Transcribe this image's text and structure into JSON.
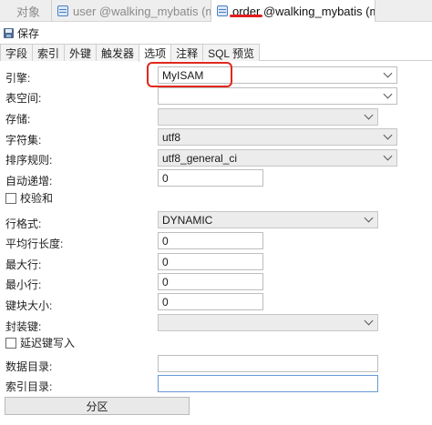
{
  "tabs": [
    {
      "label": "对象"
    },
    {
      "label": "user @walking_mybatis (my..."
    },
    {
      "label": "order @walking_mybatis (m..."
    }
  ],
  "toolbar": {
    "save_label": "保存"
  },
  "subtabs": [
    "字段",
    "索引",
    "外键",
    "触发器",
    "选项",
    "注释",
    "SQL 预览"
  ],
  "form": {
    "engine": {
      "label": "引擎:",
      "value": "MyISAM"
    },
    "tablespace": {
      "label": "表空间:",
      "value": ""
    },
    "storage": {
      "label": "存储:",
      "value": ""
    },
    "charset": {
      "label": "字符集:",
      "value": "utf8"
    },
    "collation": {
      "label": "排序规则:",
      "value": "utf8_general_ci"
    },
    "auto_increment": {
      "label": "自动递增:",
      "value": "0"
    },
    "checksum": {
      "label": "校验和",
      "checked": false
    },
    "row_format": {
      "label": "行格式:",
      "value": "DYNAMIC"
    },
    "avg_row_length": {
      "label": "平均行长度:",
      "value": "0"
    },
    "max_rows": {
      "label": "最大行:",
      "value": "0"
    },
    "min_rows": {
      "label": "最小行:",
      "value": "0"
    },
    "key_block_size": {
      "label": "键块大小:",
      "value": "0"
    },
    "pack_keys": {
      "label": "封装键:",
      "value": ""
    },
    "delay_key_write": {
      "label": "延迟键写入",
      "checked": false
    },
    "data_directory": {
      "label": "数据目录:",
      "value": ""
    },
    "index_directory": {
      "label": "索引目录:",
      "value": ""
    }
  },
  "partition_button": "分区",
  "colors": {
    "highlight": "#e0281c",
    "underline": "#e02020"
  }
}
